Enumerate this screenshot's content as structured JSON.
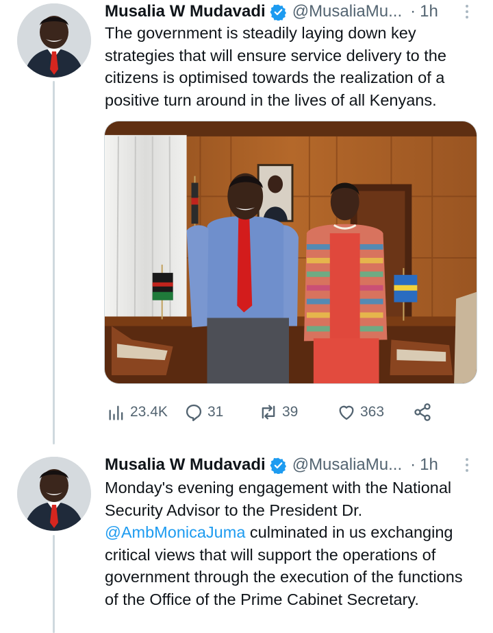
{
  "tweets": [
    {
      "author_name": "Musalia W Mudavadi",
      "handle": "@MusaliaMu...",
      "separator": "·",
      "time": "1h",
      "text": "The government is steadily laying down key strategies that will ensure service delivery to the citizens is optimised towards the realization of a positive turn around in the lives of all Kenyans.",
      "stats": {
        "views": "23.4K",
        "replies": "31",
        "retweets": "39",
        "likes": "363"
      }
    },
    {
      "author_name": "Musalia W Mudavadi",
      "handle": "@MusaliaMu...",
      "separator": "·",
      "time": "1h",
      "text_before_mention": "Monday's evening engagement with the National Security Advisor to the President Dr. ",
      "mention": "@AmbMonicaJuma",
      "text_after_mention": " culminated in us exchanging critical views that will support the operations of government through the execution of the functions of the Office of the Prime Cabinet Secretary."
    }
  ],
  "icons": {
    "verified": "verified-badge-icon",
    "more": "more-vertical-icon",
    "views": "analytics-bars-icon",
    "reply": "reply-bubble-icon",
    "retweet": "retweet-arrows-icon",
    "like": "heart-icon",
    "share": "share-nodes-icon"
  },
  "colors": {
    "text": "#0f1419",
    "secondary": "#536471",
    "accent": "#1d9bf0",
    "thread_line": "#cfd9de"
  }
}
